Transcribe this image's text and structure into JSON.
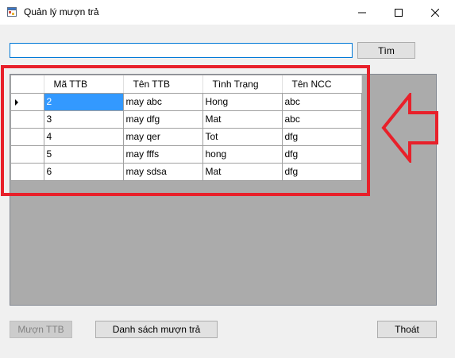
{
  "window": {
    "title": "Quản lý mượn trả"
  },
  "search": {
    "value": "",
    "placeholder": ""
  },
  "buttons": {
    "find": "Tìm",
    "borrow": "Mượn TTB",
    "borrow_list": "Danh sách mượn trả",
    "exit": "Thoát"
  },
  "table": {
    "headers": [
      "Mã TTB",
      "Tên TTB",
      "Tình Trạng",
      "Tên NCC"
    ],
    "rows": [
      [
        "2",
        "may abc",
        "Hong",
        "abc"
      ],
      [
        "3",
        "may dfg",
        "Mat",
        "abc"
      ],
      [
        "4",
        "may qer",
        "Tot",
        "dfg"
      ],
      [
        "5",
        "may fffs",
        "hong",
        "dfg"
      ],
      [
        "6",
        "may sdsa",
        "Mat",
        "dfg"
      ]
    ],
    "selected_row": 0
  },
  "colors": {
    "annotation": "#e8202a",
    "selection": "#3399ff",
    "grid_background": "#ababab",
    "input_focus_border": "#0078d7"
  },
  "icons": {
    "app": "app-window-icon",
    "minimize": "minimize-icon",
    "maximize": "maximize-icon",
    "close": "close-icon",
    "row_indicator": "row-pointer-icon",
    "annotation_arrow": "left-arrow-icon"
  }
}
